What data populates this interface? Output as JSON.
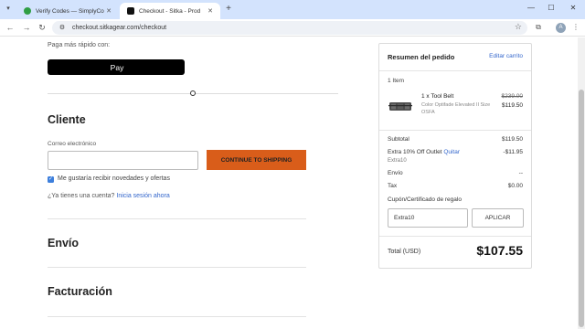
{
  "browser": {
    "tabs": [
      {
        "title": "Verify Codes — SimplyCodes",
        "favicon": "simplycodes-favicon",
        "active": false
      },
      {
        "title": "Checkout - Sitka - Prod",
        "favicon": "sitka-favicon",
        "active": true
      }
    ],
    "url": "checkout.sitkagear.com/checkout",
    "new_tab": "+",
    "profile_initial": "A"
  },
  "checkout": {
    "fast_pay_label": "Paga más rápido con:",
    "apple_pay_label": "Pay",
    "customer_heading": "Cliente",
    "email_label": "Correo electrónico",
    "email_value": "",
    "continue_label": "CONTINUE TO SHIPPING",
    "newsletter_label": "Me gustaría recibir novedades y ofertas",
    "newsletter_checked": true,
    "account_prompt": "¿Ya tienes una cuenta?",
    "login_link": "Inicia sesión ahora",
    "shipping_heading": "Envío",
    "billing_heading": "Facturación"
  },
  "summary": {
    "title": "Resumen del pedido",
    "edit_cart": "Editar carrito",
    "item_count": "1 Item",
    "item": {
      "name": "1 x Tool Belt",
      "variant": "Color Optifade Elevated II Size OSFA",
      "compare_price": "$239.00",
      "price": "$119.50"
    },
    "subtotal_label": "Subtotal",
    "subtotal_value": "$119.50",
    "discount_label": "Extra 10% Off Outlet",
    "discount_remove": "Quitar",
    "discount_code": "Extra10",
    "discount_value": "-$11.95",
    "shipping_label": "Envío",
    "shipping_value": "--",
    "tax_label": "Tax",
    "tax_value": "$0.00",
    "coupon_label": "Cupón/Certificado de regalo",
    "coupon_value": "Extra10",
    "apply_label": "APLICAR",
    "total_label": "Total (USD)",
    "total_value": "$107.55"
  },
  "colors": {
    "accent_button": "#d95d1a",
    "link": "#3366cc",
    "tabstrip": "#d3e3fd"
  }
}
